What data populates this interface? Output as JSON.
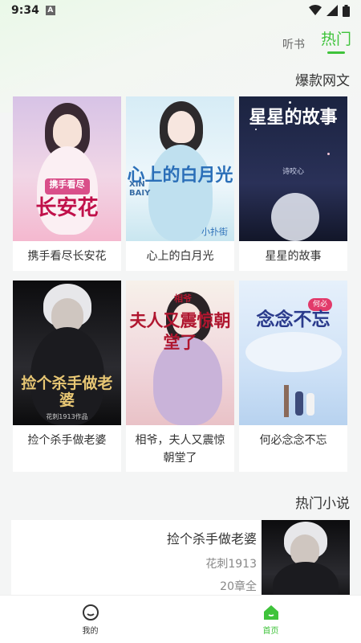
{
  "status_bar": {
    "time": "9:34",
    "notification_glyph": "A"
  },
  "header": {
    "tabs": [
      {
        "label": "听书",
        "active": false
      },
      {
        "label": "热门",
        "active": true
      }
    ]
  },
  "section_hot_web": {
    "title": "爆款网文",
    "books": [
      {
        "title": "携手看尽长安花",
        "cover_text": "长安花",
        "cover_top": "携手看尽"
      },
      {
        "title": "心上的白月光",
        "cover_text": "心上的白月光",
        "cover_top": "XIN BAIY",
        "cover_author": "小扑街"
      },
      {
        "title": "星星的故事",
        "cover_text": "星星的故事",
        "cover_author": "诗咬心"
      },
      {
        "title": "捡个杀手做老婆",
        "cover_text": "捡个杀手做老婆",
        "cover_author": "花刺1913作品"
      },
      {
        "title": "相爷，夫人又震惊朝堂了",
        "cover_text": "夫人又震惊朝堂了",
        "cover_top": "相爷"
      },
      {
        "title": "何必念念不忘",
        "cover_text": "念念不忘",
        "cover_top": "何必"
      }
    ]
  },
  "section_hot_novel": {
    "title": "热门小说",
    "items": [
      {
        "title": "捡个杀手做老婆",
        "author": "花刺1913",
        "chapters": "20章全"
      }
    ]
  },
  "bottom_nav": {
    "items": [
      {
        "label": "我的",
        "active": false
      },
      {
        "label": "首页",
        "active": true
      }
    ]
  },
  "colors": {
    "accent": "#3fc33b",
    "text": "#333333",
    "muted": "#888888"
  }
}
